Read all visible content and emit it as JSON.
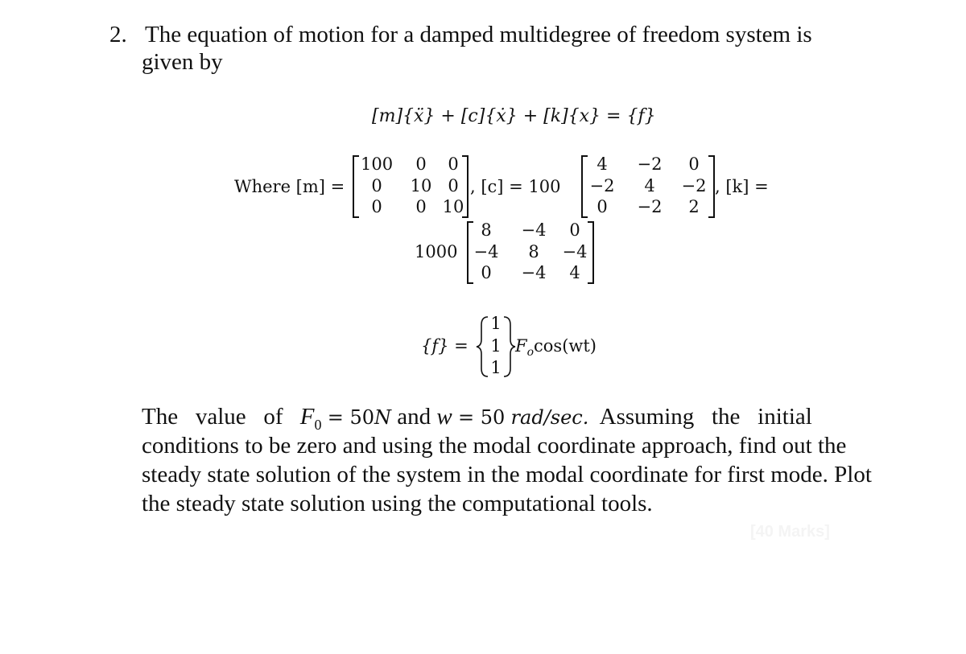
{
  "question": {
    "number": "2.",
    "intro_line1": "The equation of motion for a damped multidegree of freedom system is",
    "intro_line2": "given by"
  },
  "equation": {
    "main": "[m]{ẍ} + [c]{ẋ} + [k]{x} = {f}"
  },
  "matrices": {
    "where_label": "Where [m] =",
    "m": {
      "label": "[m]",
      "scalar": "",
      "rows": [
        [
          "100",
          "0",
          "0"
        ],
        [
          "0",
          "10",
          "0"
        ],
        [
          "0",
          "0",
          "10"
        ]
      ]
    },
    "c": {
      "label": ", [c] = 100",
      "scalar": "100",
      "rows": [
        [
          "4",
          "−2",
          "0"
        ],
        [
          "−2",
          "4",
          "−2"
        ],
        [
          "0",
          "−2",
          "2"
        ]
      ]
    },
    "k": {
      "label": ", [k] =",
      "scalar": "1000",
      "rows": [
        [
          "8",
          "−4",
          "0"
        ],
        [
          "−4",
          "8",
          "−4"
        ],
        [
          "0",
          "−4",
          "4"
        ]
      ]
    }
  },
  "force": {
    "lhs": "{f} =",
    "vector": [
      "1",
      "1",
      "1"
    ],
    "rhs_F": "F",
    "rhs_sub": "o",
    "rhs_tail": "cos(wt)"
  },
  "problem": {
    "line1_a": "The   value   of",
    "F0": "F",
    "F0_sub": "0",
    "line1_b": "= 50",
    "unitN": "N",
    "line1_c": "and",
    "w": "w",
    "line1_d": "= 50",
    "unit_rad": "rad/sec.",
    "line1_e": "Assuming   the   initial",
    "line2": "conditions to be zero and using the modal coordinate approach, find out the",
    "line3": "steady state solution of the system in the modal coordinate for first mode. Plot",
    "line4": "the steady state solution using the computational tools."
  },
  "watermark": "[40 Marks]"
}
